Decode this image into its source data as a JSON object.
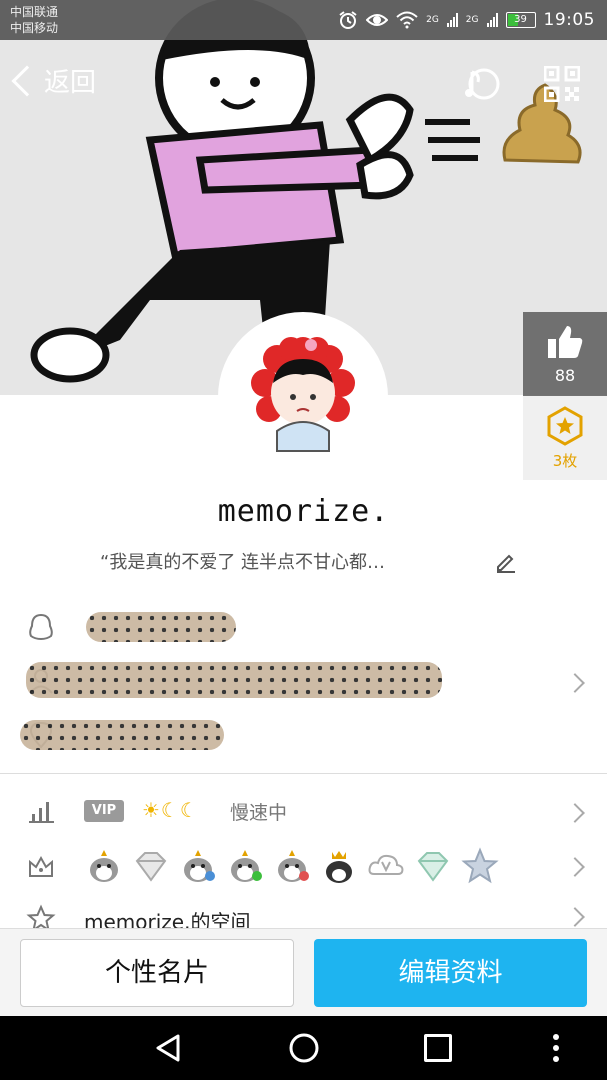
{
  "status_bar": {
    "carrier_1": "中国联通",
    "carrier_2": "中国移动",
    "network_1": "2G",
    "network_2": "2G",
    "battery": "39",
    "time": "19:05",
    "icons": [
      "alarm-icon",
      "eye-icon",
      "wifi-icon",
      "signal-icon",
      "battery-icon"
    ]
  },
  "header": {
    "back_label": "返回",
    "music_icon": "music-icon",
    "qr_icon": "qr-code-icon"
  },
  "side": {
    "like_count": "88",
    "medal_count": "3枚"
  },
  "profile": {
    "nickname": "memorize.",
    "signature": "“我是真的不爱了 连半点不甘心都…"
  },
  "info_rows": [
    {
      "icon": "qq-penguin-icon"
    },
    {
      "icon": "person-icon"
    },
    {
      "icon": "location-icon"
    }
  ],
  "level_row": {
    "icon": "level-icon",
    "vip_label": "VIP",
    "level_glyphs": "☀☾☾",
    "status": "慢速中"
  },
  "badges_row": {
    "icon": "crown-icon",
    "badges": [
      "penguin-badge-1",
      "diamond-badge",
      "penguin-badge-2",
      "penguin-badge-3",
      "penguin-badge-4",
      "penguin-badge-5",
      "vip-cloud-badge",
      "green-diamond-badge",
      "star-badge"
    ]
  },
  "space_row": {
    "icon": "star-outline-icon",
    "label": "memorize.的空间"
  },
  "actions": {
    "card_label": "个性名片",
    "edit_label": "编辑资料"
  },
  "colors": {
    "accent": "#1eb4f0",
    "medal": "#e3a200"
  }
}
